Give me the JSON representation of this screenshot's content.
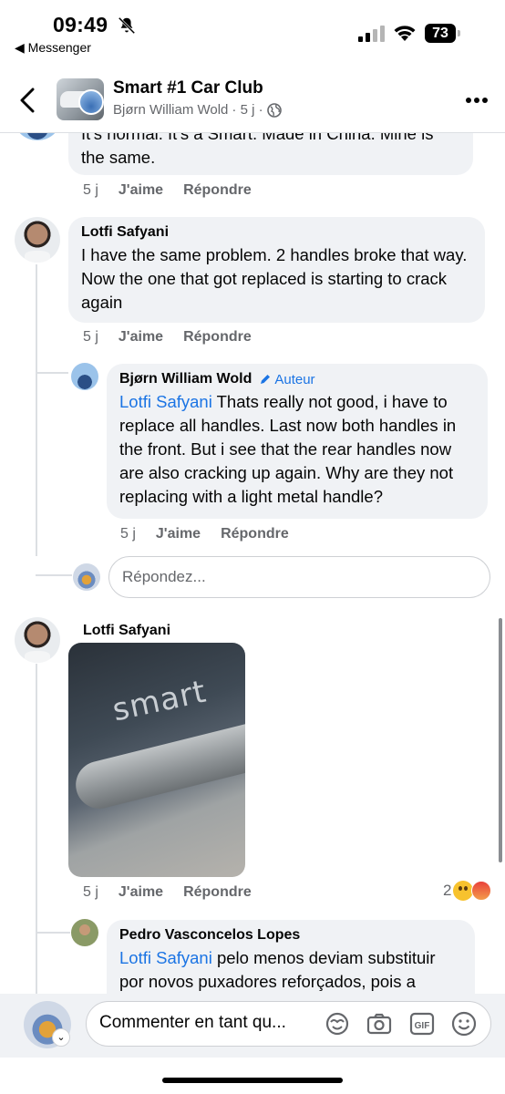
{
  "status_bar": {
    "time": "09:49",
    "back_app": "◀ Messenger",
    "battery": "73"
  },
  "header": {
    "group_name": "Smart #1 Car Club",
    "author": "Bjørn William Wold",
    "age": "· 5 j ·"
  },
  "comments": {
    "top_partial": {
      "text": "It's normal. It's a Smart. Made in China. Mine is the same.",
      "time": "5 j",
      "like": "J'aime",
      "reply": "Répondre"
    },
    "lotfi1": {
      "author": "Lotfi Safyani",
      "text": "I have the same problem. 2 handles broke that way. Now the one that got replaced is starting to crack again",
      "time": "5 j",
      "like": "J'aime",
      "reply": "Répondre"
    },
    "bjorn": {
      "author": "Bjørn William Wold",
      "badge": "Auteur",
      "mention": "Lotfi Safyani",
      "text": " Thats really not good, i have to replace all handles. Last now both handles in the front. But i see that the rear handles now are also cracking up again. Why are they not replacing with a light metal handle?",
      "time": "5 j",
      "like": "J'aime",
      "reply": "Répondre"
    },
    "reply_placeholder": "Répondez...",
    "lotfi2": {
      "author": "Lotfi Safyani",
      "photo_text": "smart",
      "time": "5 j",
      "like": "J'aime",
      "reply": "Répondre",
      "reaction_count": "2"
    },
    "pedro": {
      "author": "Pedro Vasconcelos Lopes",
      "mention": "Lotfi Safyani",
      "text": " pelo menos deviam substituir por novos puxadores reforçados, pois a"
    }
  },
  "composer": {
    "placeholder": "Commenter en tant qu...",
    "caret": "⌄"
  },
  "colors": {
    "link": "#1b74e4",
    "bubble": "#f0f2f5",
    "muted": "#65676b"
  },
  "icons": [
    "bell-slash-icon",
    "signal-icon",
    "wifi-icon",
    "back-chevron-icon",
    "globe-icon",
    "more-icon",
    "pencil-icon",
    "avatar-sticker-icon",
    "camera-icon",
    "gif-icon",
    "emoji-icon"
  ]
}
